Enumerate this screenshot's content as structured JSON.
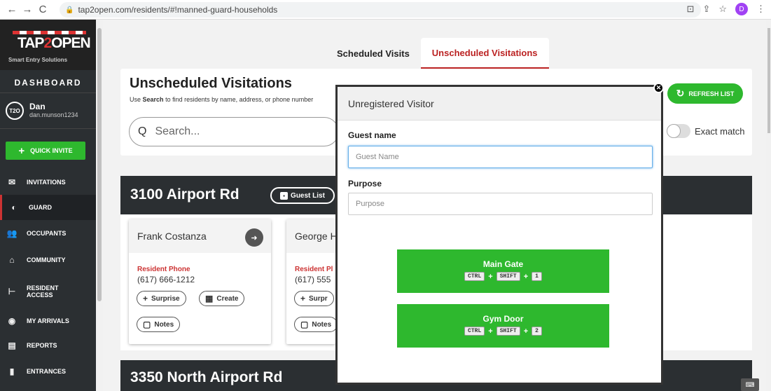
{
  "browser": {
    "url": "tap2open.com/residents/#!manned-guard-households",
    "profile_initial": "D"
  },
  "brand": {
    "part1": "TAP",
    "part2": "2",
    "part3": "OPEN",
    "tagline": "Smart Entry Solutions"
  },
  "sidebar": {
    "dashboard_label": "DASHBOARD",
    "avatar_text": "T2O",
    "user_name": "Dan",
    "user_email": "dan.munson1234",
    "quick_invite": "QUICK INVITE",
    "items": [
      {
        "label": "INVITATIONS",
        "icon": "envelope"
      },
      {
        "label": "GUARD",
        "icon": "shield"
      },
      {
        "label": "OCCUPANTS",
        "icon": "users"
      },
      {
        "label": "COMMUNITY",
        "icon": "buildings"
      },
      {
        "label": "RESIDENT ACCESS",
        "icon": "gate-arm"
      },
      {
        "label": "MY ARRIVALS",
        "icon": "eye"
      },
      {
        "label": "REPORTS",
        "icon": "clipboard"
      },
      {
        "label": "ENTRANCES",
        "icon": "door"
      }
    ]
  },
  "tabs": [
    "Scheduled Visits",
    "Unscheduled Visitations"
  ],
  "header": {
    "title": "Unscheduled Visitations",
    "sub_prefix": "Use",
    "sub_bold": "Search",
    "sub_suffix": "to find residents by name, address, or phone number",
    "search_placeholder": "Search...",
    "refresh_label": "REFRESH LIST",
    "exact_match": "Exact match"
  },
  "buildings": [
    {
      "name": "3100 Airport Rd",
      "guest_list": "Guest List",
      "cards": [
        {
          "name": "Frank Costanza",
          "phone_label": "Resident Phone",
          "phone": "(617) 666-1212",
          "btn_surprise": "Surprise",
          "btn_create": "Create",
          "btn_notes": "Notes"
        },
        {
          "name": "George H",
          "phone_label": "Resident Pl",
          "phone": "(617) 555",
          "btn_surprise": "Surpr",
          "btn_notes": "Notes"
        }
      ]
    },
    {
      "name": "3350 North Airport Rd"
    }
  ],
  "modal": {
    "title": "Unregistered Visitor",
    "guest_label": "Guest name",
    "guest_placeholder": "Guest Name",
    "purpose_label": "Purpose",
    "purpose_placeholder": "Purpose",
    "gates": [
      {
        "name": "Main Gate",
        "keys": [
          "CTRL",
          "SHIFT",
          "1"
        ]
      },
      {
        "name": "Gym Door",
        "keys": [
          "CTRL",
          "SHIFT",
          "2"
        ]
      }
    ]
  },
  "colors": {
    "accent_green": "#2eb82e",
    "accent_red": "#b22222",
    "sidebar_bg": "#2b2f32"
  }
}
